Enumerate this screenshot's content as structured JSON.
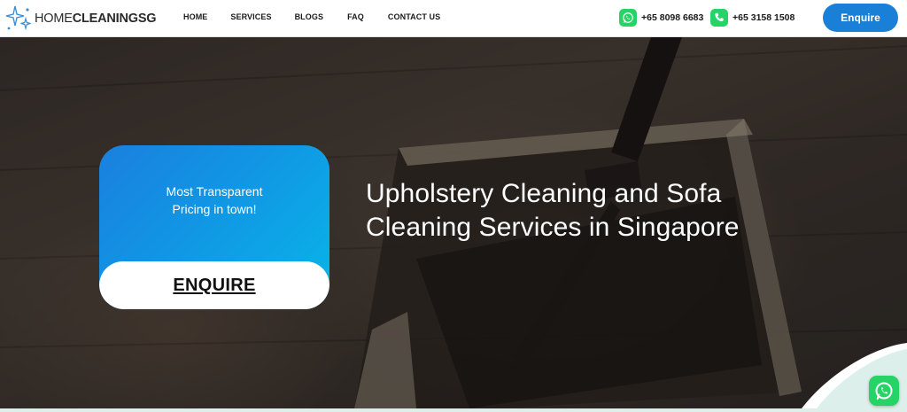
{
  "brand": {
    "name_part1": "HOME",
    "name_part2": "CLEANING",
    "name_part3": "SG",
    "logo_icon": "sparkles-icon"
  },
  "nav": {
    "items": [
      {
        "label": "HOME"
      },
      {
        "label": "SERVICES"
      },
      {
        "label": "BLOGS"
      },
      {
        "label": "FAQ"
      },
      {
        "label": "CONTACT US"
      }
    ]
  },
  "contact": {
    "whatsapp_number": "+65 8098 6683",
    "whatsapp_icon": "whatsapp-icon",
    "phone_number": "+65 3158 1508",
    "phone_icon": "phone-icon"
  },
  "header_cta": {
    "label": "Enquire"
  },
  "hero": {
    "title": "Upholstery Cleaning and Sofa Cleaning Services in Singapore",
    "card": {
      "tagline_line1": "Most Transparent",
      "tagline_line2": "Pricing in town!",
      "button_label": "ENQUIRE"
    }
  },
  "floating_chat": {
    "icon": "whatsapp-icon"
  },
  "colors": {
    "accent_blue": "#1a7fd6",
    "card_gradient_start": "#1a80de",
    "card_gradient_end": "#08b6e8",
    "whatsapp_green": "#25d366",
    "mint": "#dcefeb"
  }
}
